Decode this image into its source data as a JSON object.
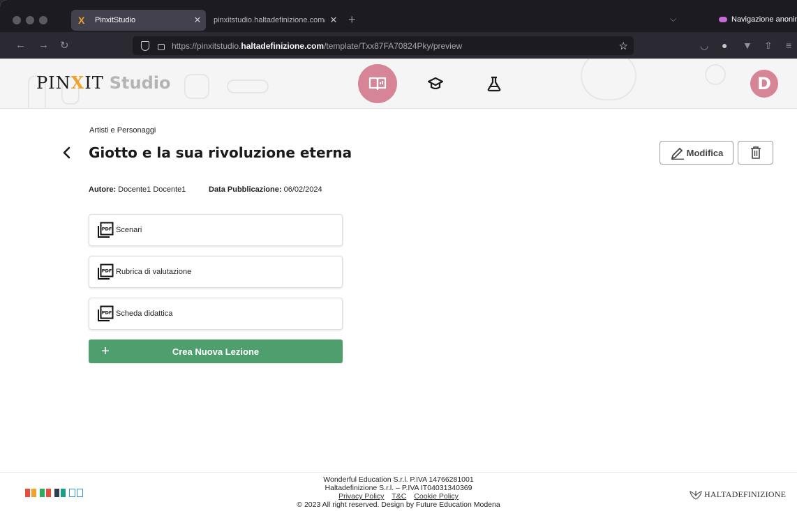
{
  "browser": {
    "tabs": [
      {
        "title": "PinxitStudio",
        "active": true
      },
      {
        "title": "pinxitstudio.haltadefinizione.com/te",
        "active": false
      }
    ],
    "private_label": "Navigazione anonima",
    "url_prefix": "https://pinxitstudio.",
    "url_domain": "haltadefinizione.com",
    "url_path": "/template/Txx87FA70824Pky/preview"
  },
  "header": {
    "logo_main": "PIN",
    "logo_x": "X",
    "logo_it": "IT",
    "logo_studio": "Studio",
    "avatar_initial": "D",
    "accent_color": "#d68597"
  },
  "lesson": {
    "category": "Artisti e Personaggi",
    "title": "Giotto e la sua rivoluzione eterna",
    "author_label": "Autore:",
    "author": "Docente1 Docente1",
    "date_label": "Data Pubblicazione:",
    "date": "06/02/2024",
    "edit_label": "Modifica",
    "documents": [
      {
        "label": "Scenari",
        "icon": "pdf-icon"
      },
      {
        "label": "Rubrica di valutazione",
        "icon": "pdf-icon"
      },
      {
        "label": "Scheda didattica",
        "icon": "pdf-icon"
      }
    ],
    "new_lesson_label": "Crea Nuova Lezione",
    "new_lesson_plus": "+",
    "primary_color": "#4f9e6d"
  },
  "footer": {
    "line1": "Wonderful Education S.r.l. P.IVA 14766281001",
    "line2": "Haltadefinizione S.r.l. – P.IVA IT04031340369",
    "privacy": "Privacy Policy",
    "tc": "T&C",
    "cookie": "Cookie Policy",
    "copyright": "© 2023 All right reserved. Design by Future Education Modena",
    "brand": "HALTADEFINIZIONE"
  }
}
